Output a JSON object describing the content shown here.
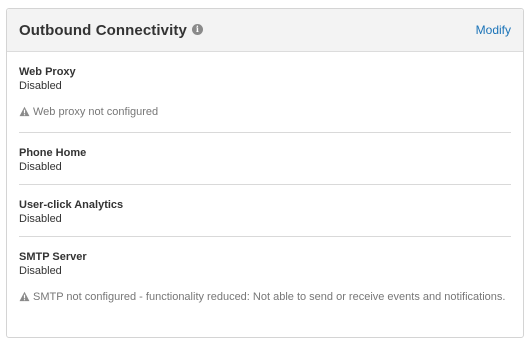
{
  "panel": {
    "title": "Outbound Connectivity",
    "info_icon": "info-icon",
    "modify_label": "Modify"
  },
  "sections": [
    {
      "label": "Web Proxy",
      "value": "Disabled",
      "warning": "Web proxy not configured"
    },
    {
      "label": "Phone Home",
      "value": "Disabled"
    },
    {
      "label": "User-click Analytics",
      "value": "Disabled"
    },
    {
      "label": "SMTP Server",
      "value": "Disabled",
      "warning": "SMTP not configured - functionality reduced: Not able to send or receive events and notifications."
    }
  ],
  "colors": {
    "link": "#1a73b8",
    "header_bg": "#f3f3f3",
    "warning_text": "#777777"
  }
}
